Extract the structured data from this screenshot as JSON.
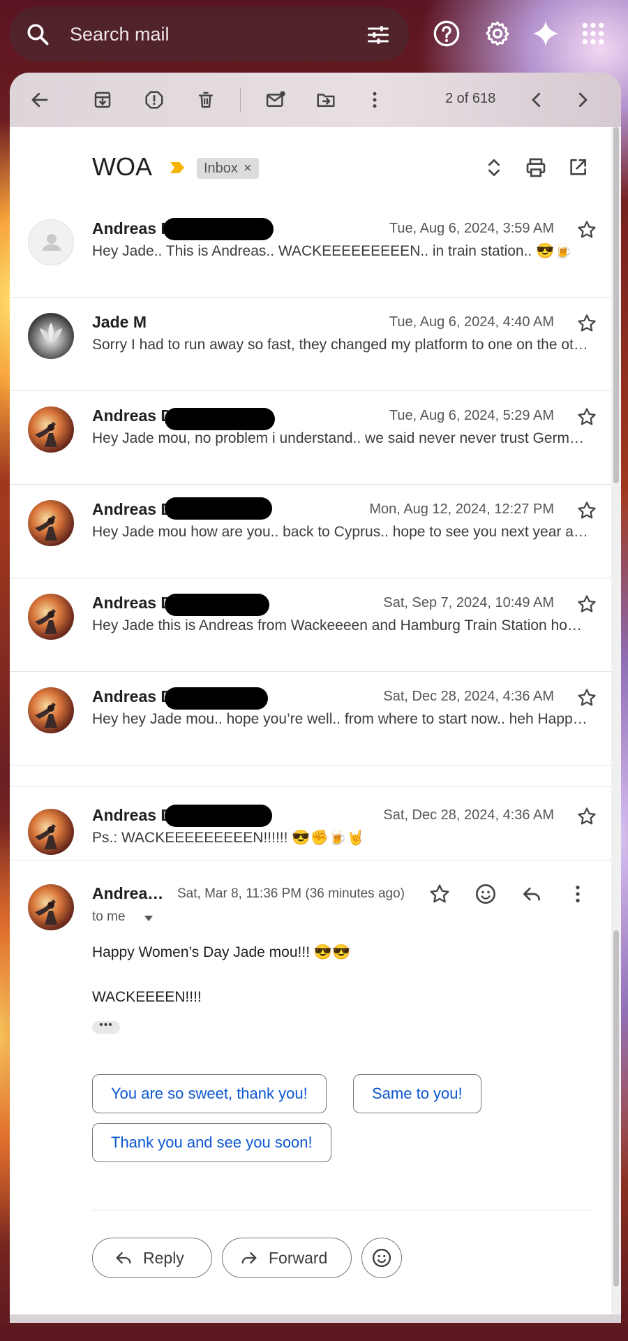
{
  "search": {
    "placeholder": "Search mail"
  },
  "toolbar": {
    "pager": "2 of 618"
  },
  "thread": {
    "subject": "WOA",
    "label": "Inbox",
    "label_remove": "×"
  },
  "messages": [
    {
      "sender": "Andreas D",
      "date": "Tue, Aug 6, 2024, 3:59 AM",
      "snippet": "Hey Jade.. This is Andreas.. WACKEEEEEEEEEN.. in train station.. 😎🍺"
    },
    {
      "sender": "Jade M",
      "date": "Tue, Aug 6, 2024, 4:40 AM",
      "snippet": "Sorry I had to run away so fast, they changed my platform to one on the other side of the station"
    },
    {
      "sender": "Andreas D",
      "date": "Tue, Aug 6, 2024, 5:29 AM",
      "snippet": "Hey Jade mou, no problem i understand.. we said never never trust German trains"
    },
    {
      "sender": "Andreas D",
      "date": "Mon, Aug 12, 2024, 12:27 PM",
      "snippet": "Hey Jade mou how are you.. back to Cyprus.. hope to see you next year at Wacken"
    },
    {
      "sender": "Andreas D",
      "date": "Sat, Sep 7, 2024, 10:49 AM",
      "snippet": "Hey Jade this is Andreas from Wackeeeen and Hamburg Train Station how are you"
    },
    {
      "sender": "Andreas D",
      "date": "Sat, Dec 28, 2024, 4:36 AM",
      "snippet": "Hey hey Jade mou.. hope you’re well.. from where to start now.. heh Happy holidays"
    },
    {
      "sender": "Andreas D",
      "date": "Sat, Dec 28, 2024, 4:36 AM",
      "snippet": "Ps.: WACKEEEEEEEEEN!!!!!! 😎✊🍺🤘"
    }
  ],
  "expanded": {
    "sender": "Andreas D",
    "date": "Sat, Mar 8, 11:36 PM (36 minutes ago)",
    "to": "to me",
    "body_line1": "Happy Women’s Day Jade mou!!! 😎😎",
    "body_line2": "WACKEEEEN!!!!",
    "trimmed": "•••",
    "smart_replies": [
      "You are so sweet, thank you!",
      "Same to you!",
      "Thank you and see you soon!"
    ],
    "reply_label": "Reply",
    "forward_label": "Forward"
  },
  "colors": {
    "link_blue": "#0b57d0",
    "important_marker": "#f4b400"
  }
}
